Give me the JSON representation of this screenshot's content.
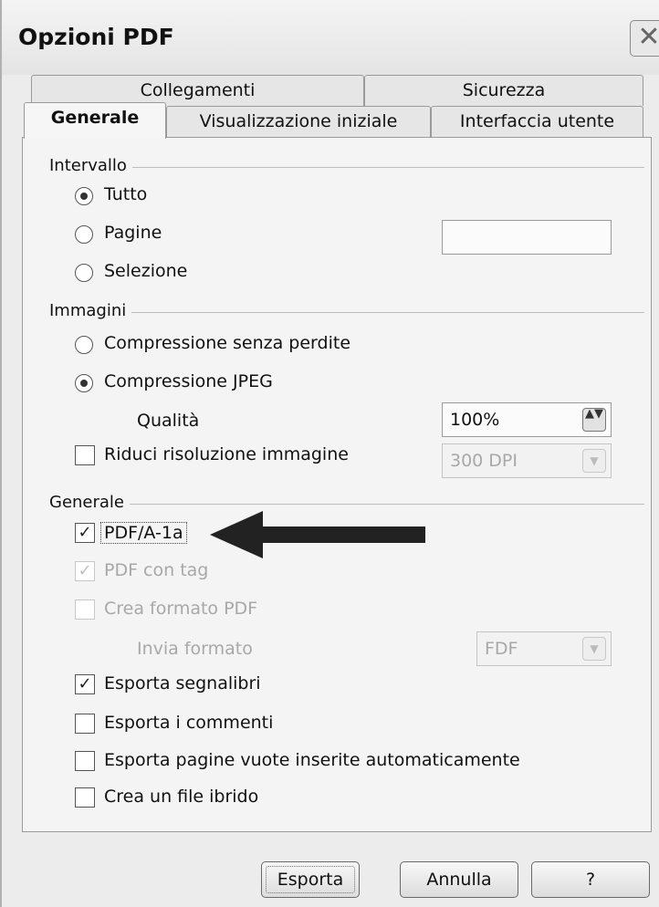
{
  "window": {
    "title": "Opzioni PDF",
    "close_glyph": "✕"
  },
  "tabs": {
    "row1": [
      "Collegamenti",
      "Sicurezza"
    ],
    "row2": [
      "Generale",
      "Visualizzazione iniziale",
      "Interfaccia utente"
    ],
    "active": "Generale"
  },
  "intervallo": {
    "label": "Intervallo",
    "options": [
      "Tutto",
      "Pagine",
      "Selezione"
    ],
    "selected": "Tutto",
    "pages_value": ""
  },
  "immagini": {
    "label": "Immagini",
    "options": [
      "Compressione senza perdite",
      "Compressione JPEG"
    ],
    "selected": "Compressione JPEG",
    "quality_label": "Qualità",
    "quality_value": "100%",
    "reduce_label": "Riduci risoluzione immagine",
    "reduce_checked": false,
    "resolution_value": "300 DPI"
  },
  "generale": {
    "label": "Generale",
    "items": [
      {
        "label": "PDF/A-1a",
        "checked": true,
        "enabled": true
      },
      {
        "label": "PDF con tag",
        "checked": true,
        "enabled": false
      },
      {
        "label": "Crea formato PDF",
        "checked": false,
        "enabled": false
      },
      {
        "label": "Esporta segnalibri",
        "checked": true,
        "enabled": true
      },
      {
        "label": "Esporta i commenti",
        "checked": false,
        "enabled": true
      },
      {
        "label": "Esporta pagine vuote inserite automaticamente",
        "checked": false,
        "enabled": true
      },
      {
        "label": "Crea un file ibrido",
        "checked": false,
        "enabled": true
      }
    ],
    "send_format_label": "Invia formato",
    "send_format_value": "FDF"
  },
  "buttons": {
    "export": "Esporta",
    "cancel": "Annulla",
    "help": "?"
  },
  "glyphs": {
    "check": "✓",
    "spin": "▲▼",
    "dropdown": "▼"
  }
}
